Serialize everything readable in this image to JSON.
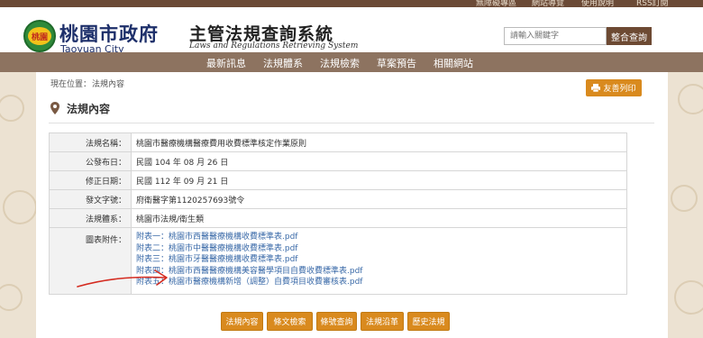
{
  "top_links": [
    "無障礙專區",
    "網站導覽",
    "使用說明",
    "RSS訂閱"
  ],
  "header": {
    "logo_seal_text": "桃園",
    "logo_cn": "桃園市政府",
    "logo_en": "Taoyuan City",
    "site_title": "主管法規查詢系統",
    "site_subtitle": "Laws and Regulations Retrieving System",
    "search_placeholder": "請輸入關鍵字",
    "search_button": "整合查詢"
  },
  "nav": {
    "items": [
      "最新訊息",
      "法規體系",
      "法規檢索",
      "草案預告",
      "相關網站"
    ]
  },
  "breadcrumb": {
    "label": "現在位置：",
    "current": "法規內容"
  },
  "print_button": "友善列印",
  "section_title": "法規內容",
  "info": {
    "rows": [
      {
        "key": "法規名稱：",
        "value": "桃園市醫療機構醫療費用收費標準核定作業原則"
      },
      {
        "key": "公發布日：",
        "value": "民國 104 年 08 月 26 日"
      },
      {
        "key": "修正日期：",
        "value": "民國 112 年 09 月 21 日"
      },
      {
        "key": "發文字號：",
        "value": "府衛醫字第1120257693號令"
      },
      {
        "key": "法規體系：",
        "value": "桃園市法規/衛生類"
      }
    ],
    "attachments_key": "圖表附件：",
    "attachments": [
      "附表一：桃園市西醫醫療機構收費標準表.pdf",
      "附表二：桃園市中醫醫療機構收費標準表.pdf",
      "附表三：桃園市牙醫醫療機構收費標準表.pdf",
      "附表四：桃園市西醫醫療機構美容醫學項目自費收費標準表.pdf",
      "附表五：桃園市醫療機構新增（調整）自費項目收費審核表.pdf"
    ]
  },
  "actions": [
    "法規內容",
    "條文檢索",
    "條號查詢",
    "法規沿革",
    "歷史法規"
  ],
  "colors": {
    "accent": "#d98a1e",
    "nav": "#8d7360",
    "brand_blue": "#1d2f6a",
    "link": "#3a6aa8"
  }
}
